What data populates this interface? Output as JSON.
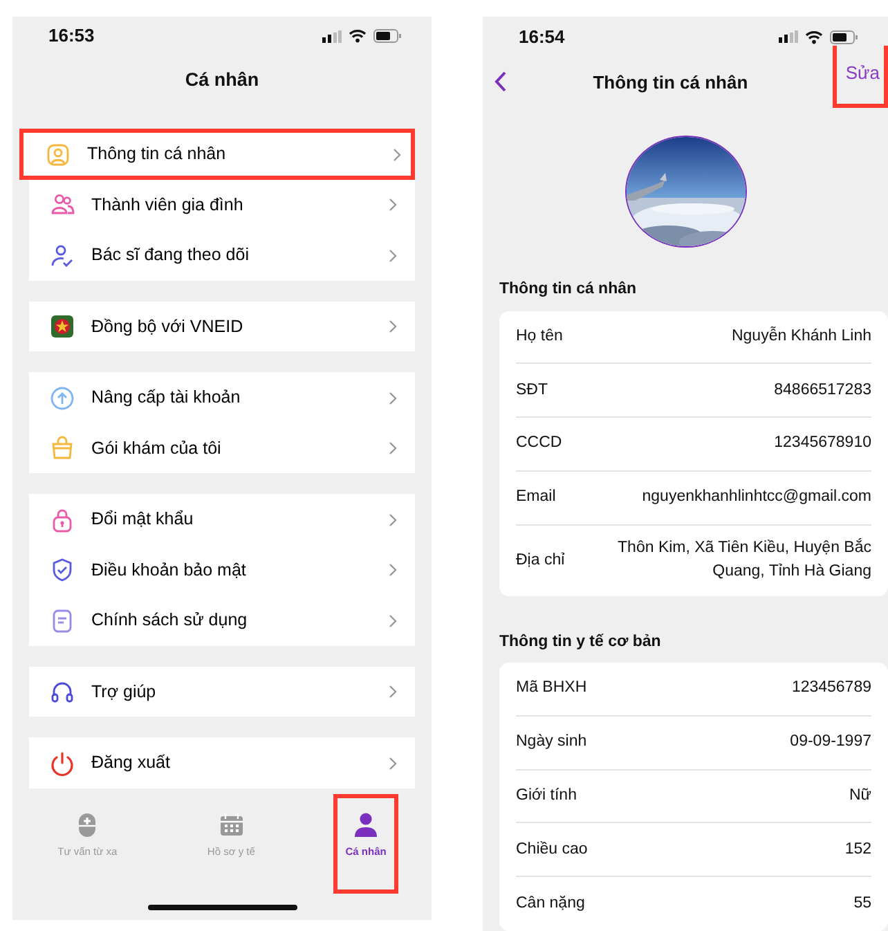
{
  "personal_screen": {
    "status_time": "16:53",
    "title": "Cá nhân",
    "menu_groups": [
      [
        {
          "kind": "profile",
          "label": "Thông tin cá nhân",
          "highlighted": true
        },
        {
          "kind": "family",
          "label": "Thành viên gia đình",
          "highlighted": false
        },
        {
          "kind": "doctor",
          "label": "Bác sĩ đang theo dõi",
          "highlighted": false
        }
      ],
      [
        {
          "kind": "vneid",
          "label": "Đồng bộ với VNEID",
          "highlighted": false
        }
      ],
      [
        {
          "kind": "upgrade",
          "label": "Nâng cấp tài khoản",
          "highlighted": false
        },
        {
          "kind": "package",
          "label": "Gói khám của tôi",
          "highlighted": false
        }
      ],
      [
        {
          "kind": "password",
          "label": "Đổi mật khẩu",
          "highlighted": false
        },
        {
          "kind": "privacy",
          "label": "Điều khoản bảo mật",
          "highlighted": false
        },
        {
          "kind": "policy",
          "label": "Chính sách sử dụng",
          "highlighted": false
        }
      ],
      [
        {
          "kind": "help",
          "label": "Trợ giúp",
          "highlighted": false
        }
      ],
      [
        {
          "kind": "logout",
          "label": "Đăng xuất",
          "highlighted": false
        }
      ]
    ],
    "tab_bar": [
      {
        "kind": "consult",
        "label": "Tư vấn từ xa",
        "selected": false,
        "highlighted": false
      },
      {
        "kind": "records",
        "label": "Hồ sơ y tế",
        "selected": false,
        "highlighted": false
      },
      {
        "kind": "person",
        "label": "Cá nhân",
        "selected": true,
        "highlighted": true
      }
    ]
  },
  "profile_screen": {
    "status_time": "16:54",
    "title": "Thông tin cá nhân",
    "edit_button": {
      "label": "Sửa",
      "highlighted": true
    },
    "sections": [
      {
        "heading": "Thông tin cá nhân",
        "rows": [
          {
            "label": "Họ tên",
            "value": "Nguyễn Khánh Linh"
          },
          {
            "label": "SĐT",
            "value": "84866517283"
          },
          {
            "label": "CCCD",
            "value": "12345678910"
          },
          {
            "label": "Email",
            "value": "nguyenkhanhlinhtcc@gmail.com"
          },
          {
            "label": "Địa chỉ",
            "value": "Thôn Kim, Xã Tiên Kiều, Huyện Bắc Quang, Tỉnh Hà Giang"
          }
        ]
      },
      {
        "heading": "Thông tin y tế cơ bản",
        "rows": [
          {
            "label": "Mã BHXH",
            "value": "123456789"
          },
          {
            "label": "Ngày sinh",
            "value": "09-09-1997"
          },
          {
            "label": "Giới tính",
            "value": "Nữ"
          },
          {
            "label": "Chiều cao",
            "value": "152"
          },
          {
            "label": "Cân nặng",
            "value": "55"
          }
        ]
      }
    ]
  }
}
